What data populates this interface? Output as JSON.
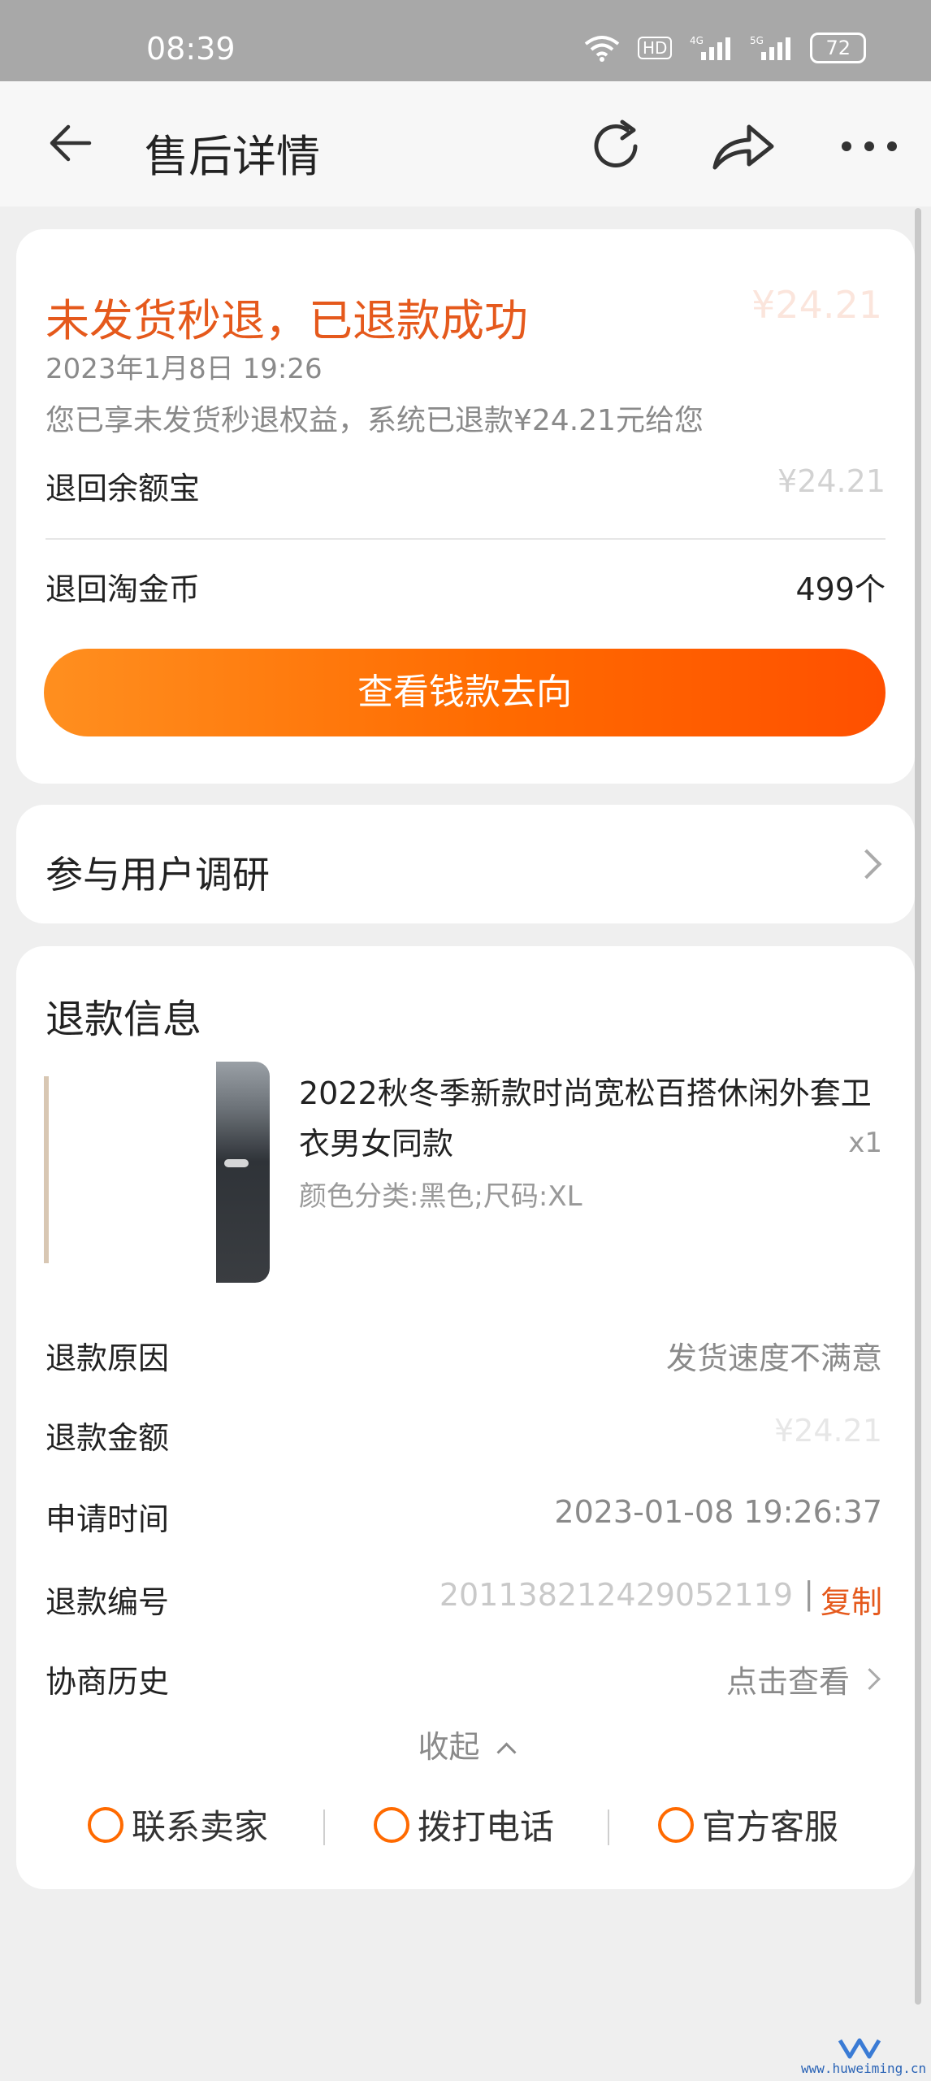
{
  "status_bar": {
    "time": "08:39",
    "icons": [
      "wifi-icon",
      "hd-icon",
      "signal-4g-icon",
      "signal-5g-icon"
    ],
    "battery": "72"
  },
  "header": {
    "title": "售后详情",
    "back_icon": "back-arrow-icon",
    "refresh_icon": "refresh-icon",
    "share_icon": "share-icon",
    "more_icon": "more-icon"
  },
  "refund_status": {
    "title": "未发货秒退，已退款成功",
    "amount_partial": "¥24.21",
    "date": "2023年1月8日  19:26",
    "description": "您已享未发货秒退权益，系统已退款¥24.21元给您",
    "rows": [
      {
        "label": "退回余额宝",
        "value": "¥24.21"
      },
      {
        "label": "退回淘金币",
        "value": "499个"
      }
    ],
    "button_label": "查看钱款去向"
  },
  "survey": {
    "label": "参与用户调研"
  },
  "refund_info": {
    "section_title": "退款信息",
    "product": {
      "name": "2022秋冬季新款时尚宽松百搭休闲外套卫衣男女同款",
      "quantity": "x1",
      "sku": "颜色分类:黑色;尺码:XL"
    },
    "rows": [
      {
        "label": "退款原因",
        "value": "发货速度不满意"
      },
      {
        "label": "退款金额",
        "value": "¥24.21"
      },
      {
        "label": "申请时间",
        "value": "2023-01-08 19:26:37"
      },
      {
        "label": "退款编号",
        "value": "201138212429052119"
      },
      {
        "label": "协商历史",
        "value": "点击查看"
      }
    ],
    "copy_label": "复制",
    "collapse_label": "收起",
    "contacts": [
      {
        "label": "联系卖家",
        "icon": "chat-icon"
      },
      {
        "label": "拨打电话",
        "icon": "phone-icon"
      },
      {
        "label": "官方客服",
        "icon": "headset-icon"
      }
    ]
  },
  "watermark": {
    "text": "www.huweiming.cn"
  },
  "colors": {
    "accent": "#e5591c",
    "button_gradient_start": "#ff8f1f",
    "button_gradient_end": "#ff5000",
    "status_bar": "#a8a8a8"
  }
}
